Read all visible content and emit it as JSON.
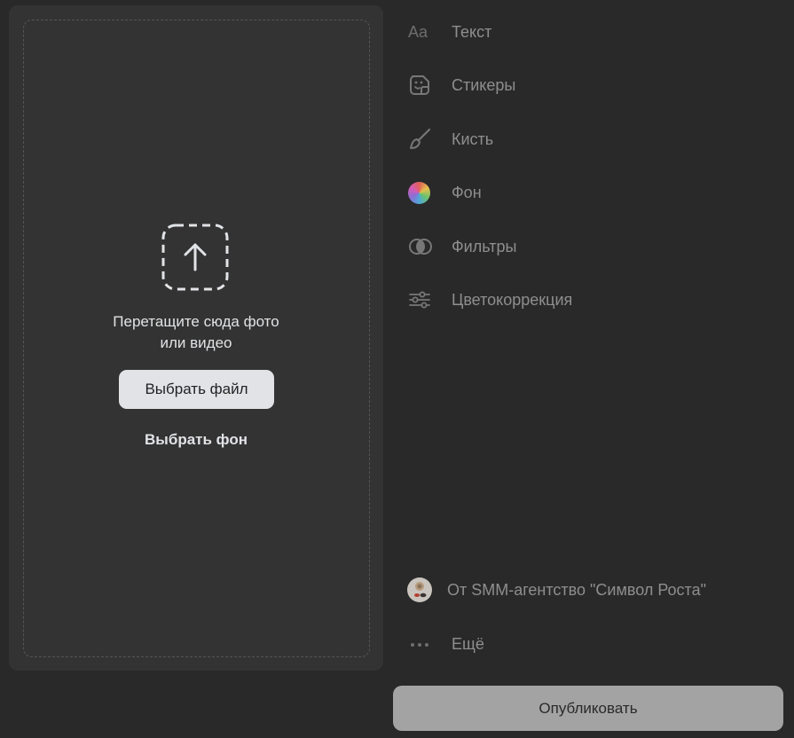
{
  "upload": {
    "drop_line1": "Перетащите сюда фото",
    "drop_line2": "или видео",
    "choose_file": "Выбрать файл",
    "choose_background": "Выбрать фон"
  },
  "tools": [
    {
      "icon": "text-icon",
      "label": "Текст"
    },
    {
      "icon": "sticker-icon",
      "label": "Стикеры"
    },
    {
      "icon": "brush-icon",
      "label": "Кисть"
    },
    {
      "icon": "color-wheel-icon",
      "label": "Фон"
    },
    {
      "icon": "filters-icon",
      "label": "Фильтры"
    },
    {
      "icon": "sliders-icon",
      "label": "Цветокоррекция"
    }
  ],
  "text_icon_glyph": "Aa",
  "author": {
    "label": "От SMM-агентство \"Символ Роста\""
  },
  "more": {
    "label": "Ещё",
    "glyph": "•••"
  },
  "publish_label": "Опубликовать",
  "colors": {
    "background": "#292929",
    "card": "#333333",
    "tool_label": "#8e8e8e",
    "publish_button": "#a3a3a3"
  }
}
